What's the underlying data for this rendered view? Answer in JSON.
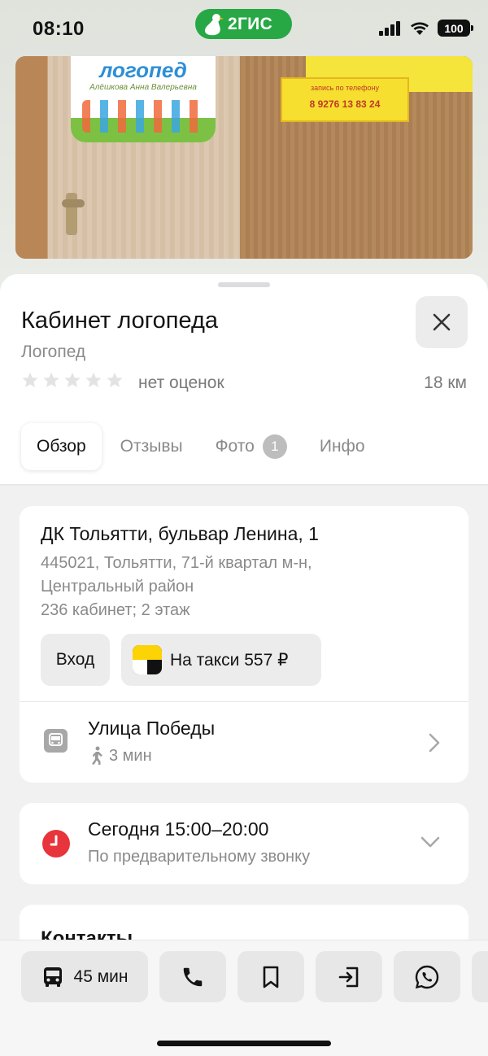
{
  "status_bar": {
    "time": "08:10",
    "app_badge": "2ГИС",
    "battery": "100"
  },
  "photo": {
    "sign_title": "логопед",
    "sign_subtitle": "Алёшкова Анна Валерьевна",
    "yellow_line1": "запись по телефону",
    "yellow_phone": "8 9276 13 83 24"
  },
  "place": {
    "title": "Кабинет логопеда",
    "category": "Логопед",
    "rating_text": "нет оценок",
    "distance": "18 км"
  },
  "tabs": [
    {
      "label": "Обзор",
      "active": true
    },
    {
      "label": "Отзывы",
      "active": false
    },
    {
      "label": "Фото",
      "badge": "1",
      "active": false
    },
    {
      "label": "Инфо",
      "active": false
    }
  ],
  "address": {
    "main": "ДК Тольятти, бульвар Ленина, 1",
    "line1": "445021, Тольятти, 71-й квартал м-н,",
    "line2": "Центральный район",
    "line3": "236 кабинет; 2 этаж",
    "enter_label": "Вход",
    "taxi_label": "На такси 557 ₽"
  },
  "transport": {
    "stop": "Улица Победы",
    "walk": "3 мин"
  },
  "hours": {
    "main": "Сегодня 15:00–20:00",
    "sub": "По предварительному звонку"
  },
  "contacts": {
    "title": "Контакты"
  },
  "bottom_bar": {
    "route_label": "45 мин"
  },
  "colors": {
    "brand_green": "#27a845",
    "clock_red": "#e8343b",
    "taxi_yellow": "#fcd305"
  }
}
